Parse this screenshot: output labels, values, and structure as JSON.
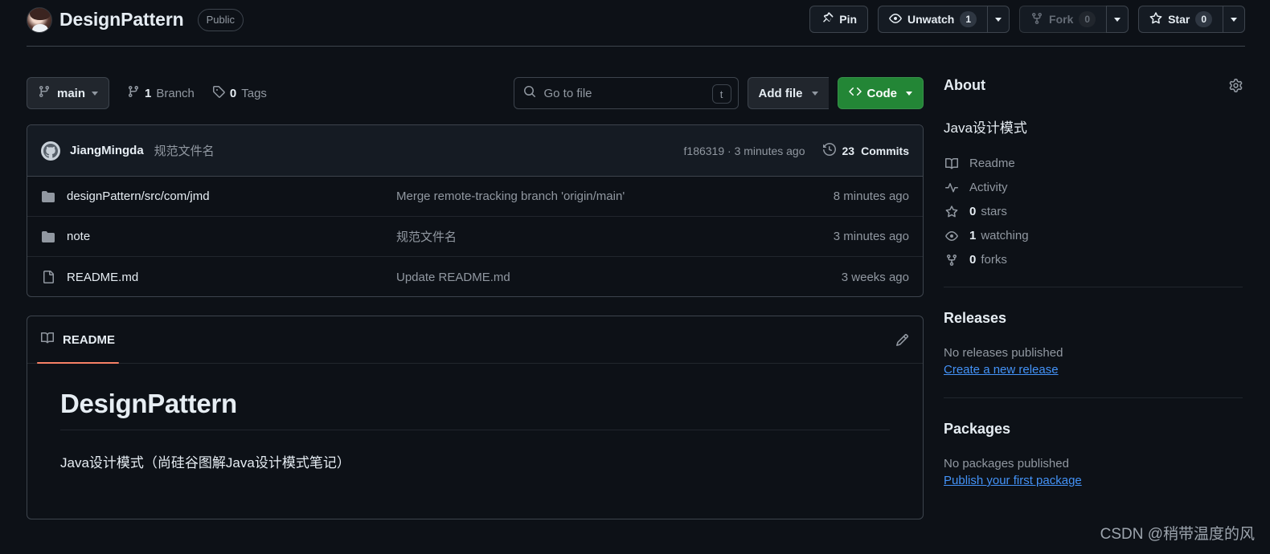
{
  "header": {
    "avatar_icon": "user-avatar",
    "repo_name": "DesignPattern",
    "visibility": "Public",
    "actions": {
      "pin": {
        "label": "Pin",
        "icon": "pin-icon"
      },
      "watch": {
        "label": "Unwatch",
        "count": "1",
        "icon": "eye-icon"
      },
      "fork": {
        "label": "Fork",
        "count": "0",
        "icon": "fork-icon"
      },
      "star": {
        "label": "Star",
        "count": "0",
        "icon": "star-icon"
      }
    }
  },
  "toolbar": {
    "branch": {
      "label": "main",
      "icon": "branch-icon"
    },
    "branches": {
      "count": "1",
      "label": "Branch",
      "icon": "branch-icon"
    },
    "tags": {
      "count": "0",
      "label": "Tags",
      "icon": "tag-icon"
    },
    "search": {
      "placeholder": "Go to file",
      "icon": "search-icon",
      "kbd": "t"
    },
    "add_file": "Add file",
    "code": "Code"
  },
  "commit_bar": {
    "author": "JiangMingda",
    "message": "规范文件名",
    "hash_and_time": "f186319 · 3 minutes ago",
    "commits_count": "23",
    "commits_label": "Commits",
    "history_icon": "history-icon"
  },
  "files": [
    {
      "icon": "folder-icon",
      "name": "designPattern/src/com/jmd",
      "commit": "Merge remote-tracking branch 'origin/main'",
      "time": "8 minutes ago"
    },
    {
      "icon": "folder-icon",
      "name": "note",
      "commit": "规范文件名",
      "time": "3 minutes ago"
    },
    {
      "icon": "file-icon",
      "name": "README.md",
      "commit": "Update README.md",
      "time": "3 weeks ago"
    }
  ],
  "readme": {
    "tab_label": "README",
    "tab_icon": "book-icon",
    "edit_icon": "pencil-icon",
    "heading": "DesignPattern",
    "paragraph": "Java设计模式（尚硅谷图解Java设计模式笔记）"
  },
  "sidebar": {
    "about": {
      "title": "About",
      "gear_icon": "gear-icon",
      "description": "Java设计模式",
      "items": [
        {
          "icon": "book-icon",
          "label": "Readme"
        },
        {
          "icon": "activity-icon",
          "label": "Activity"
        },
        {
          "icon": "star-icon",
          "count": "0",
          "label": "stars"
        },
        {
          "icon": "eye-icon",
          "count": "1",
          "label": "watching"
        },
        {
          "icon": "fork-icon",
          "count": "0",
          "label": "forks"
        }
      ]
    },
    "releases": {
      "title": "Releases",
      "empty": "No releases published",
      "link": "Create a new release"
    },
    "packages": {
      "title": "Packages",
      "empty": "No packages published",
      "link": "Publish your first package"
    }
  },
  "watermark": "CSDN @稍带温度的风",
  "colors": {
    "background": "#0d1117",
    "panel_border": "#3d444d",
    "accent_green": "#238636",
    "link_blue": "#4493f8",
    "tab_underline": "#f78166",
    "muted_text": "#9198a1"
  }
}
